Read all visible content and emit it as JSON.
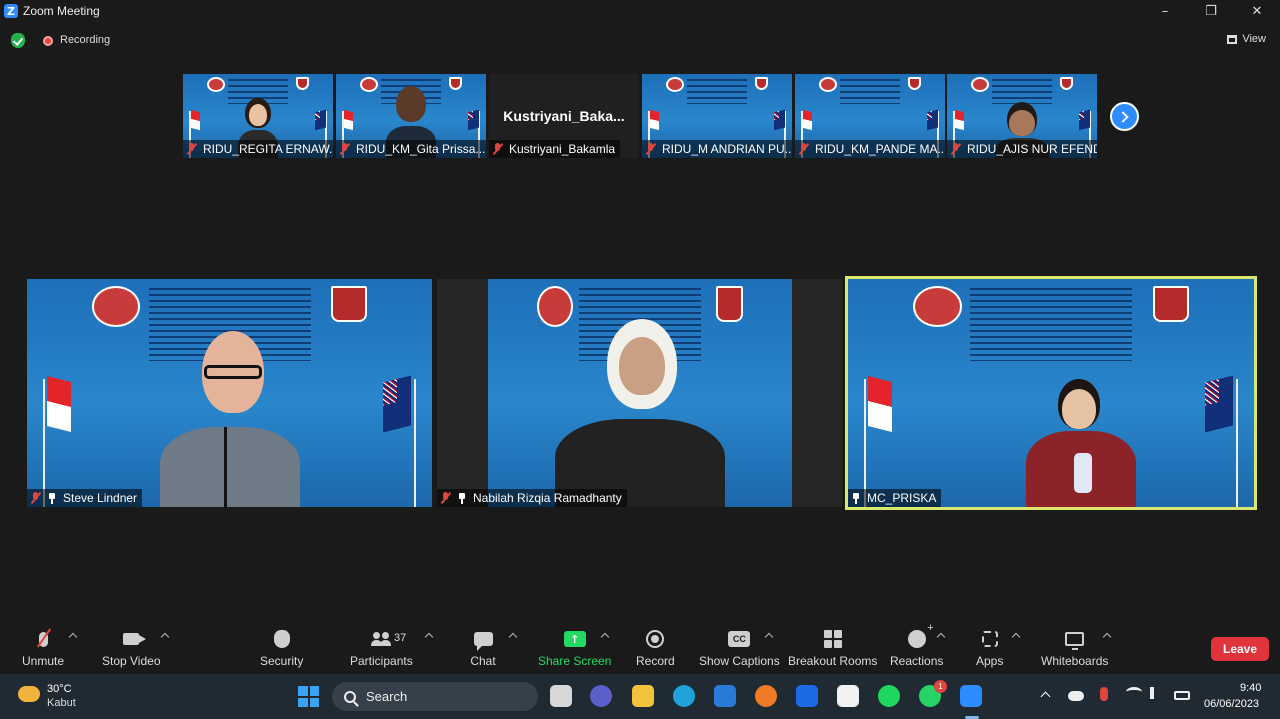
{
  "window": {
    "title": "Zoom Meeting"
  },
  "info_bar": {
    "recording_label": "Recording",
    "view_label": "View"
  },
  "filmstrip": [
    {
      "name": "RIDU_REGITA ERNAW...",
      "video": true
    },
    {
      "name": "RIDU_KM_Gita Prissa...",
      "video": true
    },
    {
      "name": "Kustriyani_Bakamla",
      "display_name": "Kustriyani_Baka...",
      "video": false
    },
    {
      "name": "RIDU_M ANDRIAN PU...",
      "video": true
    },
    {
      "name": "RIDU_KM_PANDE MA...",
      "video": true
    },
    {
      "name": "RIDU_AJIS NUR EFENDI",
      "video": true
    }
  ],
  "main_tiles": [
    {
      "name": "Steve Lindner",
      "pinned": true,
      "muted": true
    },
    {
      "name": "Nabilah Rizqia Ramadhanty",
      "pinned": true,
      "muted": true
    },
    {
      "name": "MC_PRISKA",
      "pinned": true,
      "muted": false,
      "active_speaker": true
    }
  ],
  "toolbar": {
    "unmute": "Unmute",
    "stop_video": "Stop Video",
    "security": "Security",
    "participants": "Participants",
    "participants_count": "37",
    "chat": "Chat",
    "share_screen": "Share Screen",
    "record": "Record",
    "show_captions": "Show Captions",
    "breakout_rooms": "Breakout Rooms",
    "reactions": "Reactions",
    "apps": "Apps",
    "whiteboards": "Whiteboards",
    "leave": "Leave",
    "captions_icon_text": "CC"
  },
  "taskbar": {
    "weather_temp": "30°C",
    "weather_condition": "Kabut",
    "search_placeholder": "Search",
    "time": "9:40",
    "date": "06/06/2023",
    "whatsapp_badge": "1"
  },
  "colors": {
    "accent": "#2d8cff",
    "share_green": "#23d964",
    "leave_red": "#e0333c",
    "active_speaker": "#d9e86a"
  }
}
